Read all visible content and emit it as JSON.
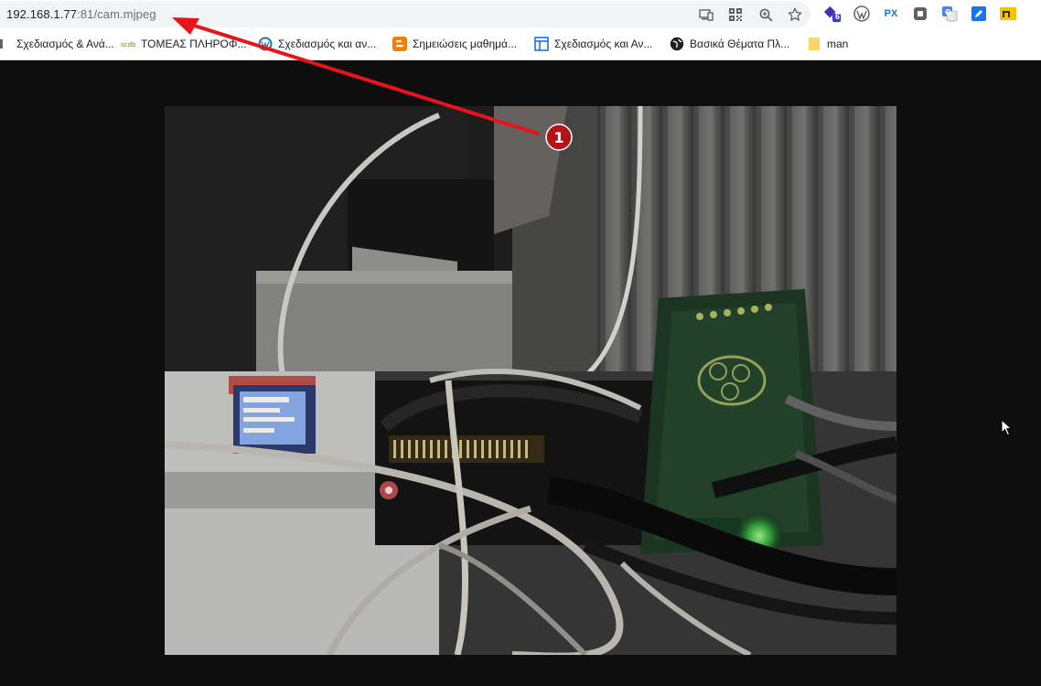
{
  "address_bar": {
    "host": "192.168.1.77",
    "path": ":81/cam.mjpeg"
  },
  "omnibox_icons": [
    "cast-icon",
    "qr-code-icon",
    "zoom-icon",
    "star-icon"
  ],
  "extensions": [
    {
      "name": "extension-badge-icon",
      "badge": "6"
    },
    {
      "name": "wordpress-icon"
    },
    {
      "name": "px-icon",
      "label": "PX"
    },
    {
      "name": "extension-square-icon"
    },
    {
      "name": "translate-icon"
    },
    {
      "name": "edit-icon"
    },
    {
      "name": "folder-icon"
    }
  ],
  "bookmarks": [
    {
      "label": "Σχεδιασμός & Ανά...",
      "icon": "folder-icon"
    },
    {
      "label": "ΤΟΜΕΑΣ ΠΛΗΡΟΦ...",
      "icon": "site-icon"
    },
    {
      "label": "Σχεδιασμός και αν...",
      "icon": "wordpress-icon"
    },
    {
      "label": "Σημειώσεις μαθημά...",
      "icon": "blogger-icon"
    },
    {
      "label": "Σχεδιασμός και Αν...",
      "icon": "layout-icon"
    },
    {
      "label": "Βασικά Θέματα Πλ...",
      "icon": "globe-icon"
    },
    {
      "label": "man",
      "icon": "folder-icon"
    }
  ],
  "annotation": {
    "marker_label": "1",
    "arrow_color": "#e8141a",
    "marker_color": "#b3141a"
  },
  "colors": {
    "page_bg": "#0e0e0e",
    "omnibox_bg": "#f1f3f4"
  }
}
